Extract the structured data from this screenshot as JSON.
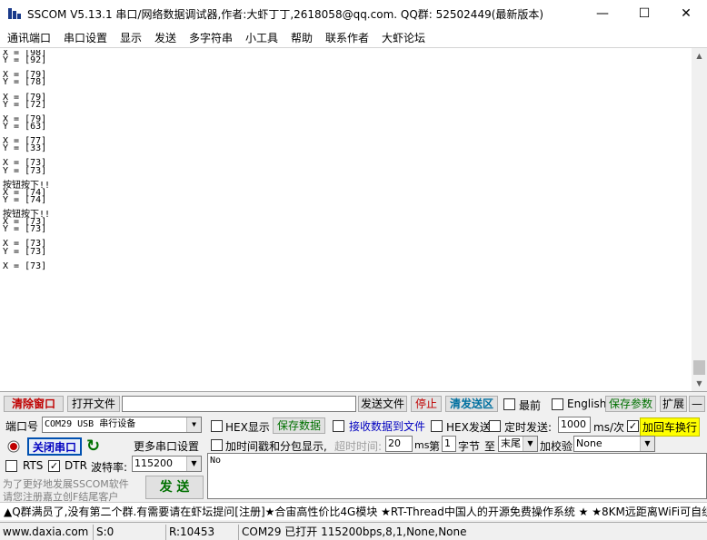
{
  "window": {
    "title": "SSCOM V5.13.1 串口/网络数据调试器,作者:大虾丁丁,2618058@qq.com. QQ群: 52502449(最新版本)",
    "minimize": "—",
    "maximize": "☐",
    "close": "✕"
  },
  "menu": [
    "通讯端口",
    "串口设置",
    "显示",
    "发送",
    "多字符串",
    "小工具",
    "帮助",
    "联系作者",
    "大虾论坛"
  ],
  "receive": {
    "text": "X = [98]\nY = [92]\n\nX = [79]\nY = [78]\n\nX = [79]\nY = [72]\n\nX = [79]\nY = [63]\n\nX = [77]\nY = [33]\n\nX = [73]\nY = [73]\n\n按钮按下!!\nX = [74]\nY = [74]\n\n按钮按下!!\nX = [73]\nY = [73]\n\nX = [73]\nY = [73]\n\nX = [73]"
  },
  "toolbar": {
    "clear_window": "清除窗口",
    "open_file": "打开文件",
    "file_path": "",
    "send_file": "发送文件",
    "stop": "停止",
    "clear_send": "清发送区",
    "topmost": "最前",
    "english": "English",
    "save_params": "保存参数",
    "expand": "扩展",
    "collapse": "—"
  },
  "port": {
    "port_label": "端口号",
    "port_value": "COM29 USB 串行设备",
    "close_port": "关闭串口",
    "more_settings": "更多串口设置",
    "rts": "RTS",
    "dtr": "DTR",
    "dtr_checked": "✓",
    "baud_label": "波特率:",
    "baud_value": "115200",
    "promo_line1": "为了更好地发展SSCOM软件",
    "promo_line2": "请您注册嘉立创F结尾客户",
    "send_button": "发 送"
  },
  "options": {
    "hex_display": "HEX显示",
    "save_data": "保存数据",
    "recv_to_file": "接收数据到文件",
    "hex_send": "HEX发送",
    "timed_send": "定时发送:",
    "interval": "1000",
    "interval_unit": "ms/次",
    "add_crlf": "加回车换行",
    "add_crlf_checked": "✓",
    "timestamp": "加时间戳和分包显示,",
    "timeout_label": "超时时间:",
    "timeout_value": "20",
    "timeout_unit": "ms",
    "nth_label": "第",
    "nth_value": "1",
    "byte_label": "字节",
    "to_label": "至",
    "to_value": "末尾",
    "checksum_label": "加校验",
    "checksum_value": "None"
  },
  "send_area": {
    "text": "No"
  },
  "ticker": "▲Q群满员了,没有第二个群.有需要请在虾坛提问[注册]★合宙高性价比4G模块 ★RT-Thread中国人的开源免费操作系统 ★ ★8KM远距离WiFi可自组",
  "status": {
    "website": "www.daxia.com",
    "sent": "S:0",
    "received": "R:10453",
    "port_status": "COM29 已打开  115200bps,8,1,None,None"
  },
  "colors": {
    "accent_red": "#c00000",
    "accent_green": "#007000",
    "accent_blue": "#0000c0",
    "highlight_yellow": "#ffff00"
  }
}
